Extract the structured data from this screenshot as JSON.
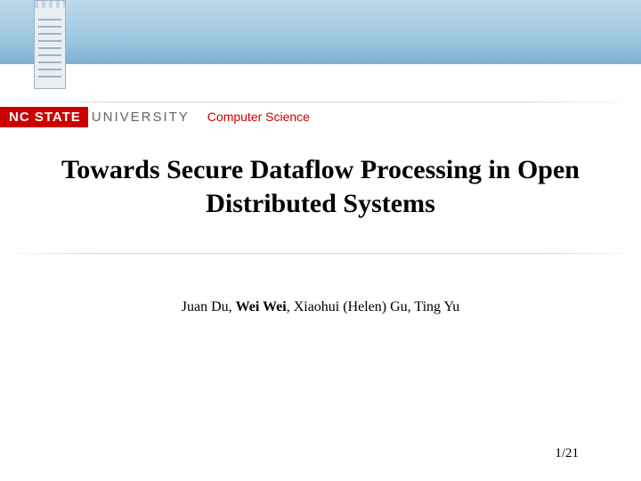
{
  "header": {
    "logo_main": "NC STATE",
    "logo_sub": "UNIVERSITY",
    "department": "Computer Science"
  },
  "slide": {
    "title": "Towards Secure Dataflow Processing in Open Distributed Systems",
    "authors_prefix": "Juan Du, ",
    "authors_bold": "Wei Wei",
    "authors_suffix": ", Xiaohui (Helen) Gu, Ting Yu",
    "page": "1/21"
  }
}
